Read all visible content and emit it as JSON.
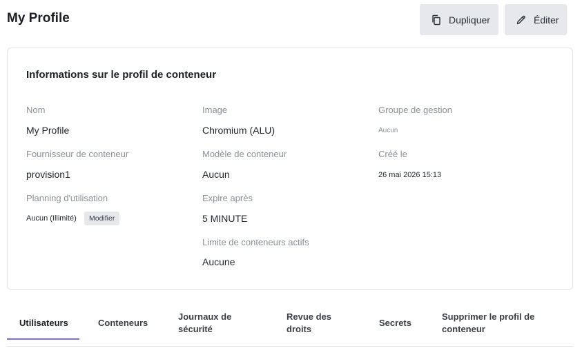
{
  "header": {
    "title": "My Profile",
    "duplicate_label": "Dupliquer",
    "edit_label": "Éditer"
  },
  "card": {
    "title": "Informations sur le profil de conteneur",
    "name_label": "Nom",
    "name_value": "My Profile",
    "provider_label": "Fournisseur de conteneur",
    "provider_value": "provision1",
    "schedule_label": "Planning d'utilisation",
    "schedule_value": "Aucun (Illimité)",
    "schedule_modify": "Modifier",
    "image_label": "Image",
    "image_value": "Chromium (ALU)",
    "template_label": "Modèle de conteneur",
    "template_value": "Aucun",
    "expire_label": "Expire après",
    "expire_value": "5 MINUTE",
    "limit_label": "Limite de conteneurs actifs",
    "limit_value": "Aucune",
    "group_label": "Groupe de gestion",
    "group_value": "Aucun",
    "created_label": "Créé le",
    "created_value": "26 mai 2026 15:13"
  },
  "tabs": {
    "users": "Utilisateurs",
    "containers": "Conteneurs",
    "security_line1": "Journaux de",
    "security_line2": "sécurité",
    "review_line1": "Revue des",
    "review_line2": "droits",
    "secrets": "Secrets",
    "delete_line1": "Supprimer le profil de",
    "delete_line2": "conteneur",
    "active_accent": "#7b6fd6"
  },
  "icons": {
    "duplicate": "copy-icon",
    "edit": "pencil-icon"
  }
}
